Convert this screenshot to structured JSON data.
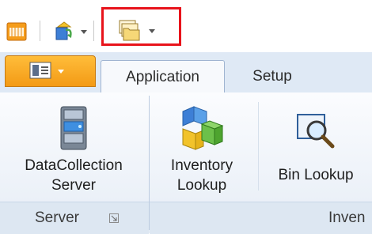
{
  "quick_access": {
    "items": [
      "toolbar-icon",
      "paint-refresh-icon",
      "folder-stack-icon"
    ]
  },
  "tabs": {
    "application": "Application",
    "setup": "Setup"
  },
  "ribbon": {
    "buttons": {
      "datacollection_line1": "DataCollection",
      "datacollection_line2": "Server",
      "inventory_line1": "Inventory",
      "inventory_line2": "Lookup",
      "bin_lookup": "Bin Lookup"
    },
    "groups": {
      "server": "Server",
      "inventory": "Inven"
    }
  },
  "colors": {
    "highlight": "#e8131b",
    "app_menu": "#f39a15",
    "tab_strip": "#dfe9f5"
  }
}
